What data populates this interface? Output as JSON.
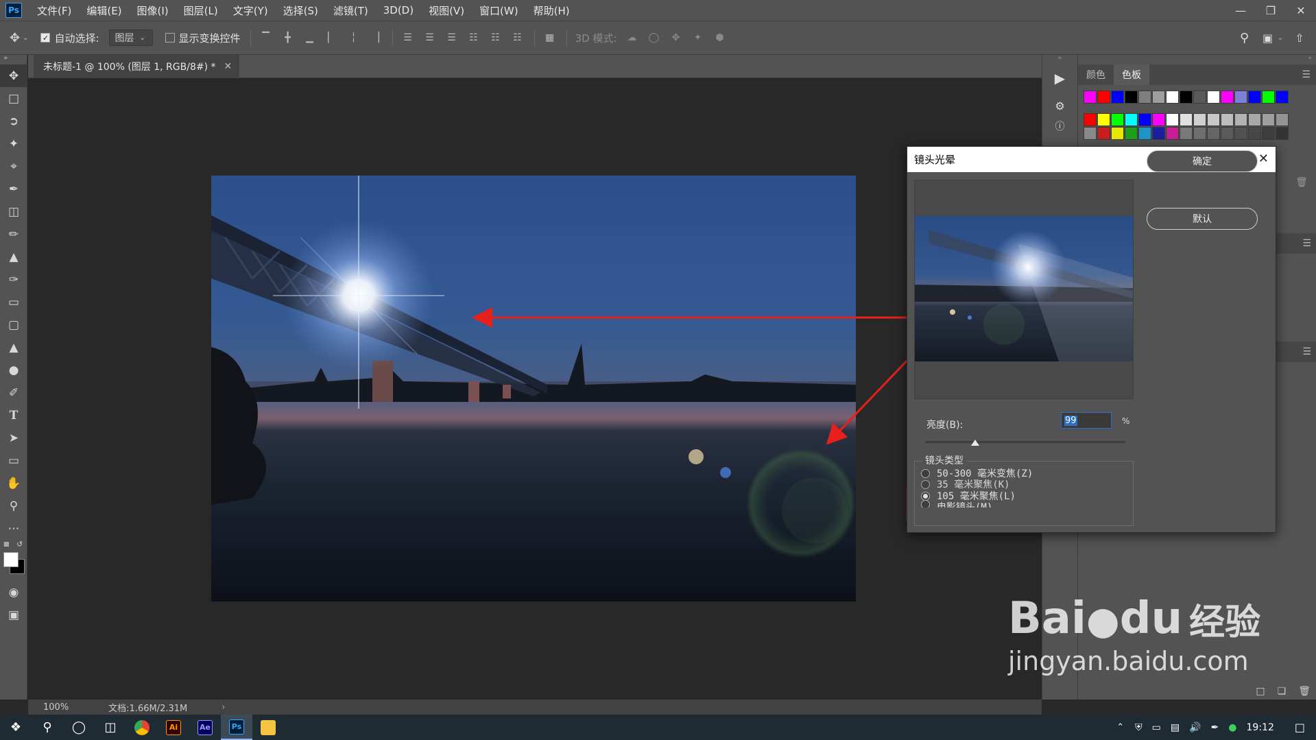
{
  "app": {
    "logo": "Ps"
  },
  "menu": [
    "文件(F)",
    "编辑(E)",
    "图像(I)",
    "图层(L)",
    "文字(Y)",
    "选择(S)",
    "滤镜(T)",
    "3D(D)",
    "视图(V)",
    "窗口(W)",
    "帮助(H)"
  ],
  "options": {
    "auto_select_label": "自动选择:",
    "auto_select_value": "图层",
    "show_transform_label": "显示变换控件",
    "mode_3d_label": "3D 模式:"
  },
  "document": {
    "tab_title": "未标题-1 @ 100% (图层 1, RGB/8#) *",
    "zoom": "100%",
    "doc_size": "文档:1.66M/2.31M"
  },
  "panels": {
    "tab_color": "颜色",
    "tab_swatches": "色板",
    "swatch_row1": [
      "#ff00ff",
      "#ff0000",
      "#0000ff",
      "#000000",
      "#7f7f7f",
      "#9e9e9e",
      "#ffffff",
      "#000000",
      "#5a5a5a",
      "#ffffff",
      "#ff00ff",
      "#7f7fd8",
      "#0000ff",
      "#00ff00",
      "#0000ff"
    ],
    "swatch_row2": [
      "#ff0000",
      "#ffff00",
      "#00ff00",
      "#00ffff",
      "#0000ff",
      "#ff00ff",
      "#ffffff",
      "#e0e0e0",
      "#d0d0d0",
      "#c8c8c8",
      "#bdbdbd",
      "#b2b2b2",
      "#a8a8a8",
      "#9e9e9e",
      "#949494"
    ],
    "swatch_row3": [
      "#8a8a8a",
      "#c81e1e",
      "#e8e800",
      "#1ea01e",
      "#1e96c8",
      "#1e1ea0",
      "#c81e96",
      "#7a7a7a",
      "#707070",
      "#666666",
      "#5c5c5c",
      "#525252",
      "#484848",
      "#3e3e3e",
      "#343434"
    ]
  },
  "dialog": {
    "title": "镜头光晕",
    "ok_label": "确定",
    "default_label": "默认",
    "brightness_label": "亮度(B):",
    "brightness_value": "99",
    "percent": "%",
    "lens_type_label": "镜头类型",
    "lens_options": [
      "50-300 毫米变焦(Z)",
      "35 毫米聚焦(K)",
      "105 毫米聚焦(L)",
      "电影镜头(M)"
    ],
    "selected_lens_index": 2,
    "brightness_fraction": 0.25
  },
  "taskbar": {
    "time": "19:12",
    "apps": {
      "ai": "Ai",
      "ae": "Ae",
      "ps": "Ps"
    }
  },
  "watermark": {
    "brand": "Bai",
    "brand2": "du",
    "product": "经验",
    "url": "jingyan.baidu.com"
  },
  "accent": "#2b6fc2",
  "annotation_color": "#e8201c"
}
